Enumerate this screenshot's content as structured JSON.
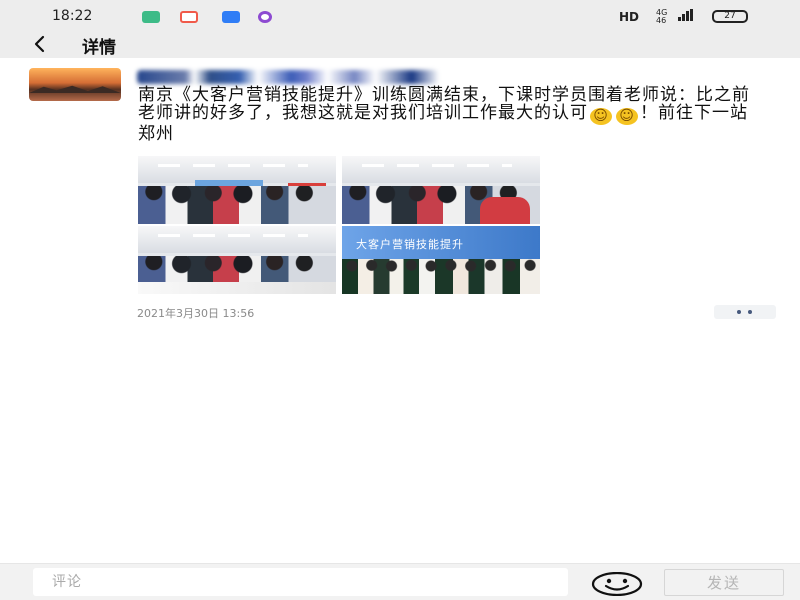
{
  "status_bar": {
    "time": "18:22",
    "hd": "HD",
    "network": "4G",
    "network_speed": "46",
    "battery": "27",
    "app_icons": [
      "wechat-icon",
      "weibo-icon",
      "translate-icon",
      "chat-icon"
    ]
  },
  "header": {
    "back_icon": "back-arrow-icon",
    "title": "详情"
  },
  "post": {
    "avatar_icon": "sunset-avatar-icon",
    "author_hidden": true,
    "text_part_1": "南京《大客户营销技能提升》训练圆满结束，下课时学员围着老师说：比之前老师讲的好多了，我想这就是对我们培训工作最大的认可",
    "text_part_2": "！前往下一站郑州",
    "emoji_names": [
      "smile-emoji-icon",
      "smile-emoji-icon"
    ],
    "photos": [
      {
        "name": "classroom-photo-1"
      },
      {
        "name": "classroom-photo-2"
      },
      {
        "name": "classroom-photo-3"
      },
      {
        "name": "group-photo"
      }
    ],
    "photo_banner_text": "大客户营销技能提升",
    "date": "2021年3月30日  13:56",
    "more_icon": "more-dots-icon"
  },
  "footer": {
    "comment_placeholder": "评论",
    "emoji_icon": "face-emoji-icon",
    "send_label": "发送"
  },
  "colors": {
    "status_bar_bg": "#ededed",
    "text": "#111111",
    "muted": "#8a8a8a",
    "more_dot": "#46597d",
    "send_disabled": "#b5b5b5"
  }
}
